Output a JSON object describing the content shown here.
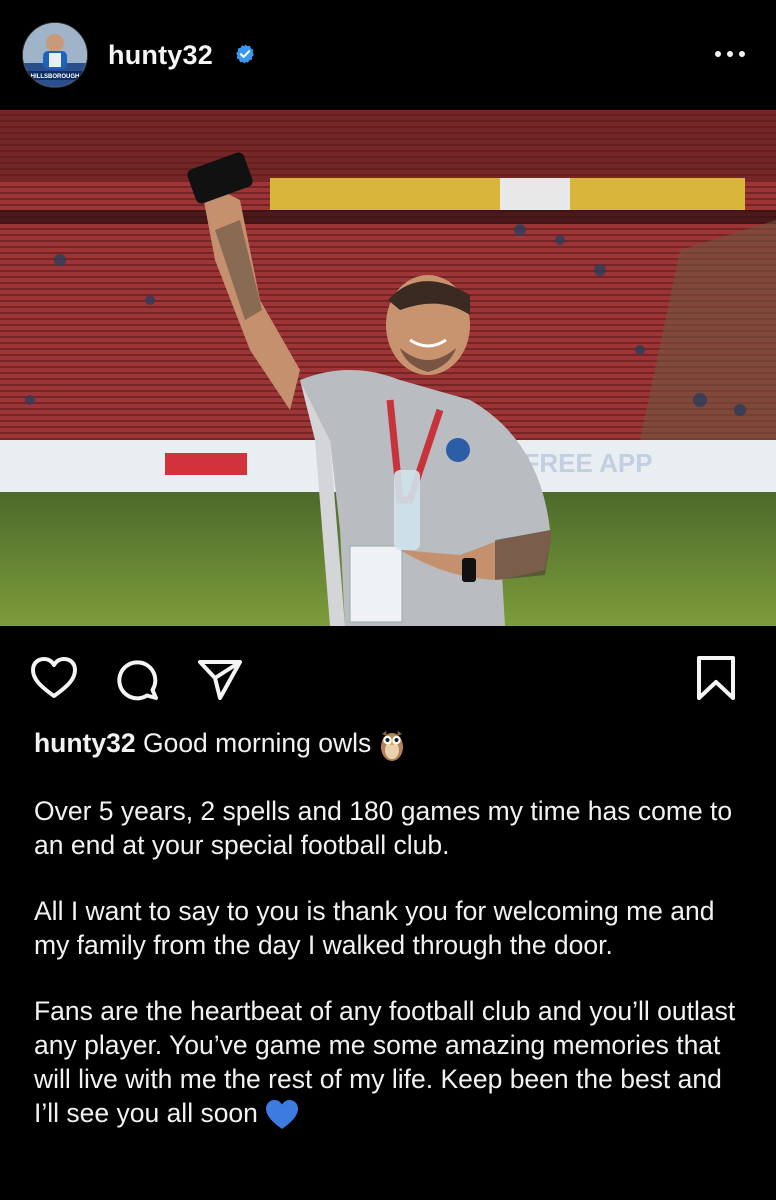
{
  "header": {
    "username": "hunty32",
    "avatar_text": "HILLSBOROUGH",
    "verified_icon": "verified-badge-icon",
    "more_icon": "more-horizontal-icon"
  },
  "photo": {
    "banner_text": "FREE APP"
  },
  "actions": {
    "icons": [
      "heart-icon",
      "comment-icon",
      "share-icon",
      "bookmark-icon"
    ]
  },
  "caption": {
    "username": "hunty32",
    "first_line": " Good morning owls ",
    "first_emoji": "owl-emoji",
    "paragraphs": [
      "Over 5 years, 2 spells and 180 games my time has come to an end at your special football club.",
      "All I want to say to you is thank you for welcoming me and my family from the day I walked through the door.",
      "Fans are the heartbeat of any football club and you’ll outlast any player. You’ve game me some amazing memories that will live with me the rest of my life. Keep been the best and I’ll see you all soon "
    ],
    "last_emoji": "blue-heart-emoji"
  },
  "colors": {
    "background": "#000000",
    "text": "#f5f5f5",
    "verified_blue": "#3897f0",
    "heart_blue": "#3d7be0"
  }
}
